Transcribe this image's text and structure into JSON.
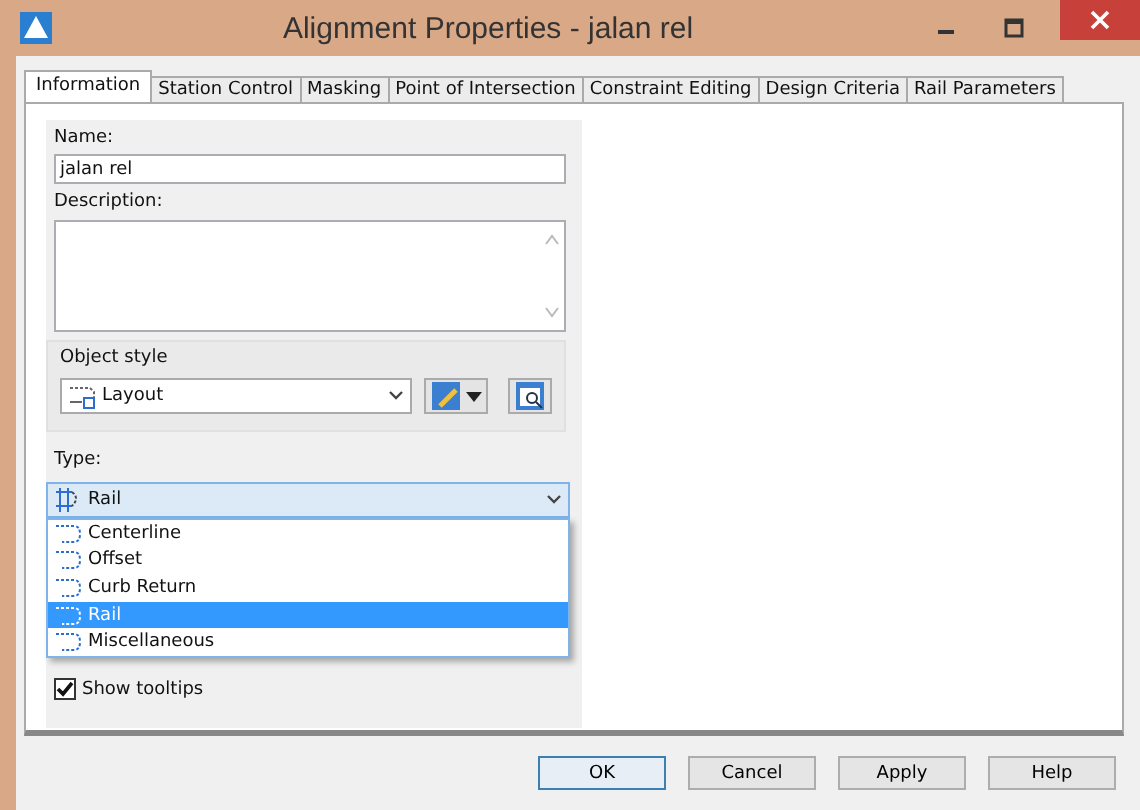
{
  "window": {
    "title": "Alignment Properties - jalan rel"
  },
  "tabs": [
    {
      "label": "Information",
      "selected": true
    },
    {
      "label": "Station Control",
      "selected": false
    },
    {
      "label": "Masking",
      "selected": false
    },
    {
      "label": "Point of Intersection",
      "selected": false
    },
    {
      "label": "Constraint Editing",
      "selected": false
    },
    {
      "label": "Design Criteria",
      "selected": false
    },
    {
      "label": "Rail Parameters",
      "selected": false
    }
  ],
  "name": {
    "label": "Name:",
    "value": "jalan rel"
  },
  "description": {
    "label": "Description:"
  },
  "object_style": {
    "label": "Object style",
    "value": "Layout"
  },
  "type": {
    "label": "Type:",
    "value": "Rail",
    "expanded": true,
    "options": [
      {
        "label": "Centerline",
        "selected": false
      },
      {
        "label": "Offset",
        "selected": false
      },
      {
        "label": "Curb Return",
        "selected": false
      },
      {
        "label": "Rail",
        "selected": true
      },
      {
        "label": "Miscellaneous",
        "selected": false
      }
    ]
  },
  "show_tooltips": {
    "label": "Show tooltips",
    "checked": true
  },
  "buttons": [
    "OK",
    "Cancel",
    "Apply",
    "Help"
  ]
}
